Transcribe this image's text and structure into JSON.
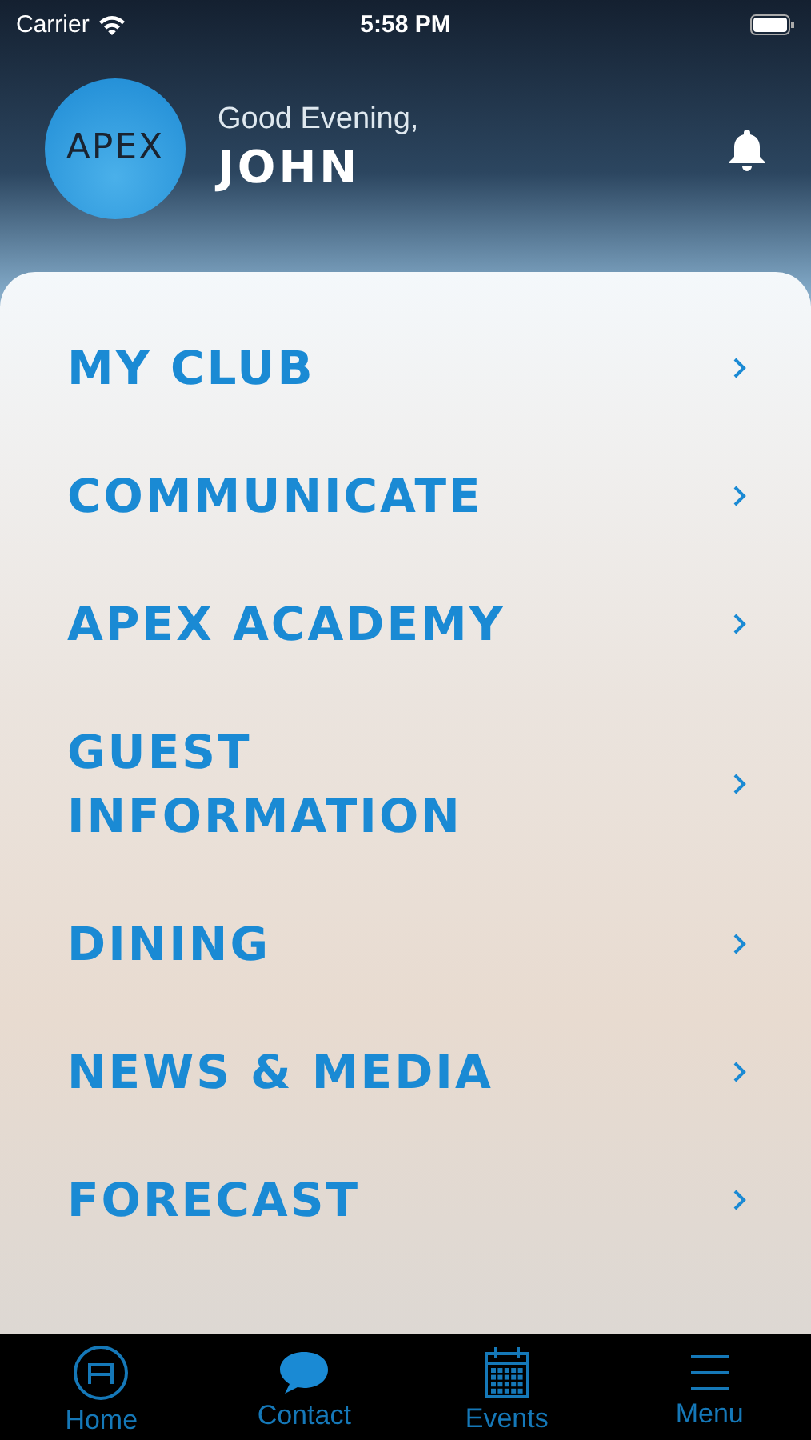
{
  "status_bar": {
    "carrier": "Carrier",
    "time": "5:58 PM"
  },
  "header": {
    "logo": "APEX",
    "greeting": "Good Evening,",
    "name": "JOHN"
  },
  "menu": [
    {
      "label": "MY CLUB"
    },
    {
      "label": "COMMUNICATE"
    },
    {
      "label": "APEX ACADEMY"
    },
    {
      "label": "GUEST INFORMATION"
    },
    {
      "label": "DINING"
    },
    {
      "label": "NEWS & MEDIA"
    },
    {
      "label": "FORECAST"
    }
  ],
  "tab_bar": [
    {
      "label": "Home",
      "kind": "home"
    },
    {
      "label": "Contact",
      "kind": "contact"
    },
    {
      "label": "Events",
      "kind": "events"
    },
    {
      "label": "Menu",
      "kind": "menu"
    }
  ]
}
